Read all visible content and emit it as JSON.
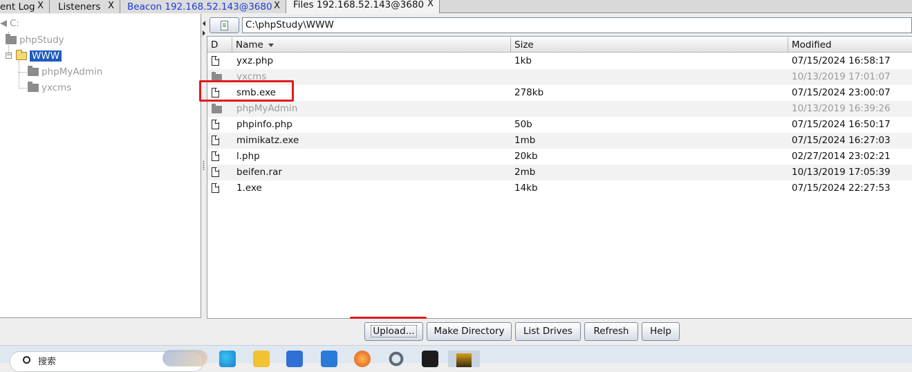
{
  "tabs": [
    {
      "label": "ent Log",
      "close": "X"
    },
    {
      "label": "Listeners",
      "close": "X"
    },
    {
      "label": "Beacon 192.168.52.143@3680",
      "close": "X"
    },
    {
      "label": "Files 192.168.52.143@3680",
      "close": "X"
    }
  ],
  "tree": {
    "drive": "C:",
    "items": [
      "phpStudy",
      "WWW",
      "phpMyAdmin",
      "yxcms"
    ]
  },
  "path": "C:\\phpStudy\\WWW",
  "table": {
    "columns": [
      "D",
      "Name",
      "Size",
      "Modified"
    ],
    "rows": [
      {
        "type": "file",
        "name": "yxz.php",
        "size": "1kb",
        "modified": "07/15/2024 16:58:17"
      },
      {
        "type": "dir",
        "name": "yxcms",
        "size": "",
        "modified": "10/13/2019 17:01:07"
      },
      {
        "type": "file",
        "name": "smb.exe",
        "size": "278kb",
        "modified": "07/15/2024 23:00:07"
      },
      {
        "type": "dir",
        "name": "phpMyAdmin",
        "size": "",
        "modified": "10/13/2019 16:39:26"
      },
      {
        "type": "file",
        "name": "phpinfo.php",
        "size": "50b",
        "modified": "07/15/2024 16:50:17"
      },
      {
        "type": "file",
        "name": "mimikatz.exe",
        "size": "1mb",
        "modified": "07/15/2024 16:27:03"
      },
      {
        "type": "file",
        "name": "l.php",
        "size": "20kb",
        "modified": "02/27/2014 23:02:21"
      },
      {
        "type": "file",
        "name": "beifen.rar",
        "size": "2mb",
        "modified": "10/13/2019 17:05:39"
      },
      {
        "type": "file",
        "name": "1.exe",
        "size": "14kb",
        "modified": "07/15/2024 22:27:53"
      }
    ]
  },
  "buttons": {
    "upload": "Upload...",
    "make_directory": "Make Directory",
    "list_drives": "List Drives",
    "refresh": "Refresh",
    "help": "Help"
  },
  "taskbar": {
    "search": "搜索"
  },
  "colors": {
    "selection": "#1e5bbd",
    "highlight": "#e0191d",
    "beacon_tab": "#1f3bd6"
  }
}
